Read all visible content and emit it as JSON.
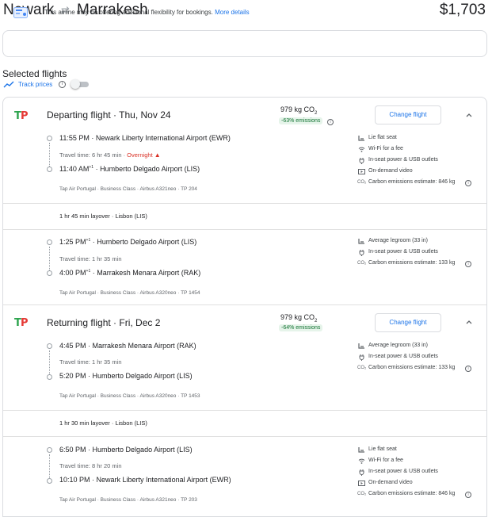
{
  "header": {
    "origin": "Newark",
    "destination": "Marrakesh",
    "price": "$1,703"
  },
  "banner": {
    "text": "This airline may be offering additional flexibility for bookings.",
    "link": "More details"
  },
  "selected": {
    "title": "Selected flights",
    "track_label": "Track prices",
    "track_on": false
  },
  "departing": {
    "title": "Departing flight",
    "date": "Thu, Nov 24",
    "co2_value": "979 kg CO",
    "co2_sub": "2",
    "emissions_badge": "-63% emissions",
    "change_button": "Change flight",
    "leg1": {
      "dep_time": "11:55 PM",
      "dep_airport": "Newark Liberty International Airport (EWR)",
      "travel_time": "Travel time: 6 hr 45 min",
      "overnight": "Overnight",
      "arr_time": "11:40 AM",
      "arr_plus": "+1",
      "arr_airport": "Humberto Delgado Airport (LIS)",
      "meta": "Tap Air Portugal · Business Class · Airbus A321neo · TP 204",
      "amenities": [
        "Lie flat seat",
        "Wi-Fi for a fee",
        "In-seat power & USB outlets",
        "On-demand video",
        "Carbon emissions estimate: 846 kg"
      ]
    },
    "layover": "1 hr 45 min layover · Lisbon (LIS)",
    "leg2": {
      "dep_time": "1:25 PM",
      "dep_plus": "+1",
      "dep_airport": "Humberto Delgado Airport (LIS)",
      "travel_time": "Travel time: 1 hr 35 min",
      "arr_time": "4:00 PM",
      "arr_plus": "+1",
      "arr_airport": "Marrakesh Menara Airport (RAK)",
      "meta": "Tap Air Portugal · Business Class · Airbus A320neo · TP 1454",
      "amenities": [
        "Average legroom (33 in)",
        "In-seat power & USB outlets",
        "Carbon emissions estimate: 133 kg"
      ]
    }
  },
  "returning": {
    "title": "Returning flight",
    "date": "Fri, Dec 2",
    "co2_value": "979 kg CO",
    "co2_sub": "2",
    "emissions_badge": "-64% emissions",
    "change_button": "Change flight",
    "leg1": {
      "dep_time": "4:45 PM",
      "dep_airport": "Marrakesh Menara Airport (RAK)",
      "travel_time": "Travel time: 1 hr 35 min",
      "arr_time": "5:20 PM",
      "arr_airport": "Humberto Delgado Airport (LIS)",
      "meta": "Tap Air Portugal · Business Class · Airbus A320neo · TP 1453",
      "amenities": [
        "Average legroom (33 in)",
        "In-seat power & USB outlets",
        "Carbon emissions estimate: 133 kg"
      ]
    },
    "layover": "1 hr 30 min layover · Lisbon (LIS)",
    "leg2": {
      "dep_time": "6:50 PM",
      "dep_airport": "Humberto Delgado Airport (LIS)",
      "travel_time": "Travel time: 8 hr 20 min",
      "arr_time": "10:10 PM",
      "arr_airport": "Newark Liberty International Airport (EWR)",
      "meta": "Tap Air Portugal · Business Class · Airbus A321neo · TP 203",
      "amenities": [
        "Lie flat seat",
        "Wi-Fi for a fee",
        "In-seat power & USB outlets",
        "On-demand video",
        "Carbon emissions estimate: 846 kg"
      ]
    }
  },
  "colors": {
    "accent": "#1a73e8",
    "emissions_green": "#137333",
    "warning_red": "#d93025",
    "tap_green": "#2ea44f",
    "tap_red": "#e53935"
  }
}
